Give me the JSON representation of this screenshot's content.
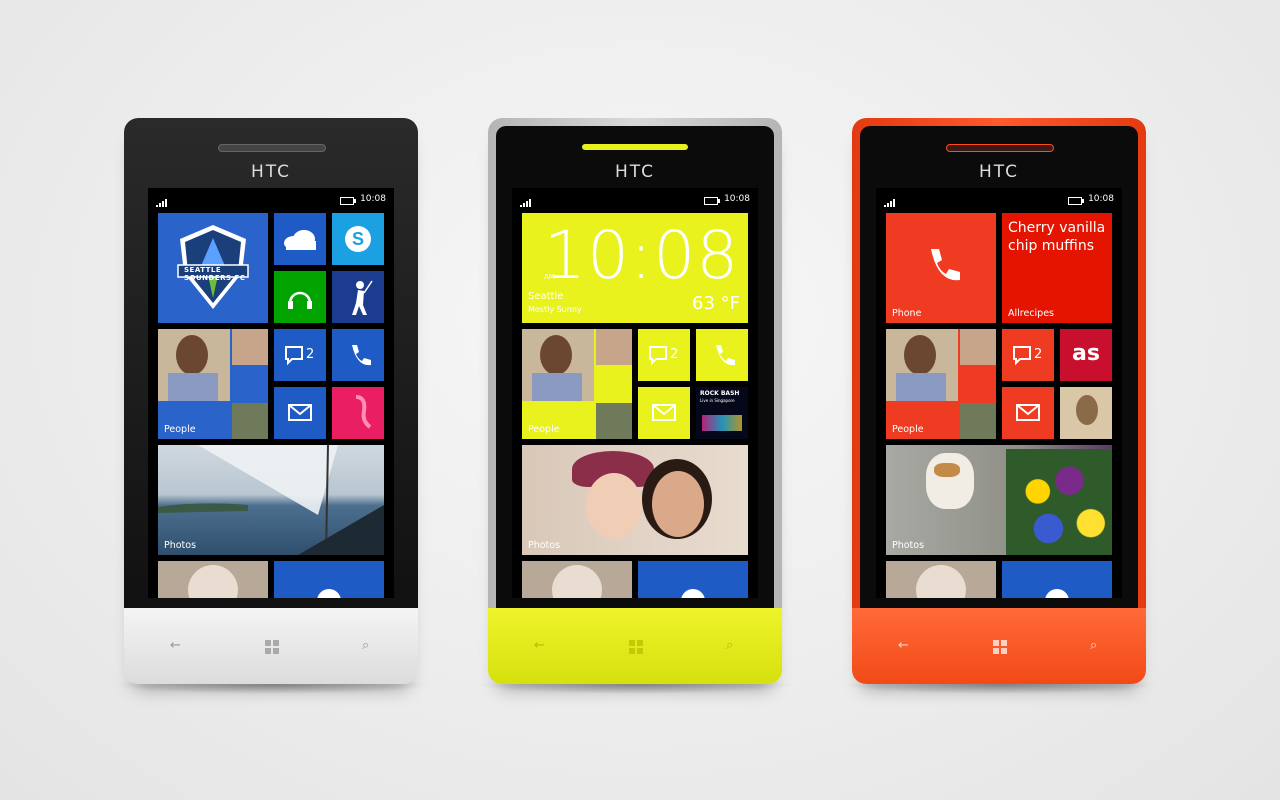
{
  "brand": "HTC",
  "clock": "10:08",
  "phones": [
    {
      "color": "#ffffff",
      "tiles": {
        "people": "People",
        "photos": "Photos",
        "msg_count": "2",
        "sounders": "SEATTLE SOUNDERS FC"
      }
    },
    {
      "color": "#e8f21a",
      "tiles": {
        "big_time": "10:08",
        "am": "AM",
        "city": "Seattle",
        "weather": "Mostly Sunny",
        "temp": "63 °F",
        "people": "People",
        "photos": "Photos",
        "msg_count": "2",
        "rock_bash": "ROCK BASH",
        "rock_bash_sub": "Live in Singapore"
      }
    },
    {
      "color": "#ff4a1c",
      "tiles": {
        "phone": "Phone",
        "recipe": "Cherry vanilla chip muffins",
        "allrecipes": "Allrecipes",
        "people": "People",
        "photos": "Photos",
        "msg_count": "2",
        "lastfm": "as"
      }
    }
  ],
  "colors": {
    "tile_blue": "#1f5bc4",
    "tile_cyan": "#1ba1e2",
    "tile_green": "#00a300",
    "tile_navy": "#1c3d8f",
    "tile_pink": "#e91e63",
    "tile_red": "#e51400",
    "tile_yellow": "#e9f21c"
  },
  "icons": [
    "onedrive-icon",
    "skype-icon",
    "music-icon",
    "golf-icon",
    "messaging-icon",
    "phone-icon",
    "mail-icon",
    "back-icon",
    "windows-icon",
    "search-icon",
    "lastfm-icon"
  ]
}
